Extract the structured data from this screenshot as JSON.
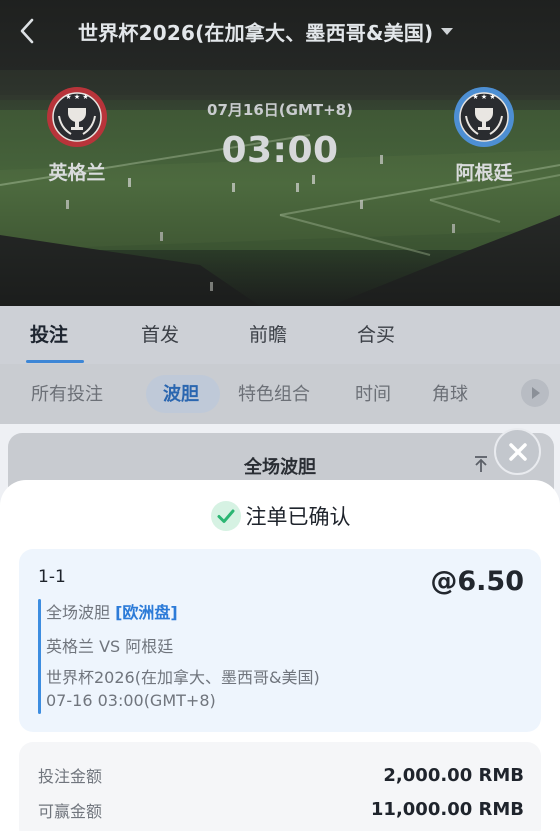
{
  "header": {
    "title": "世界杯2026(在加拿大、墨西哥&美国)",
    "back_icon": "chevron-left-icon",
    "dropdown_icon": "caret-down-icon"
  },
  "match": {
    "home_team": "英格兰",
    "away_team": "阿根廷",
    "date": "07月16日(GMT+8)",
    "time": "03:00"
  },
  "tabs": [
    {
      "label": "投注",
      "active": true
    },
    {
      "label": "首发",
      "active": false
    },
    {
      "label": "前瞻",
      "active": false
    },
    {
      "label": "合买",
      "active": false
    }
  ],
  "subtabs": [
    {
      "label": "所有投注",
      "active": false
    },
    {
      "label": "波胆",
      "active": true
    },
    {
      "label": "特色组合",
      "active": false
    },
    {
      "label": "时间",
      "active": false
    },
    {
      "label": "角球",
      "active": false
    }
  ],
  "market": {
    "title": "全场波胆"
  },
  "sheet": {
    "confirm_text": "注单已确认",
    "bet": {
      "selection": "1-1",
      "odds": "@6.50",
      "market": "全场波胆",
      "odds_type": "[欧洲盘]",
      "matchup": "英格兰 VS 阿根廷",
      "league": "世界杯2026(在加拿大、墨西哥&美国)",
      "kickoff": "07-16 03:00(GMT+8)"
    },
    "amounts": {
      "stake_label": "投注金额",
      "stake_value": "2,000.00 RMB",
      "win_label": "可赢金额",
      "win_value": "11,000.00 RMB"
    }
  },
  "colors": {
    "accent": "#3d86d6",
    "confirm_green": "#2bb673",
    "tag_blue": "#2c7bd8"
  }
}
